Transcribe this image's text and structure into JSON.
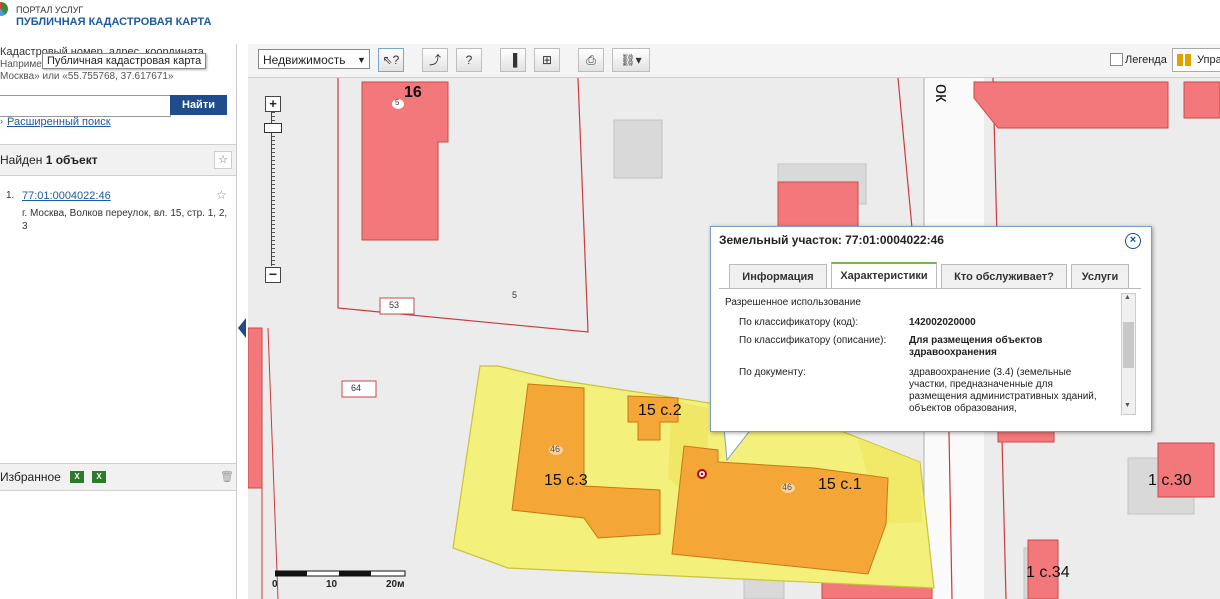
{
  "header": {
    "portal": "ПОРТАЛ УСЛУГ",
    "title": "ПУБЛИЧНАЯ КАДАСТРОВАЯ КАРТА"
  },
  "left": {
    "search_hint_line1": "Кадастровый номер, адрес, координата",
    "search_hint_line2": "Наприме",
    "search_hint_line3": "Москва» или «55.755768, 37.617671»",
    "tooltip": "Публичная кадастровая карта",
    "search_value": "",
    "find_button": "Найти",
    "advanced_search": "Расширенный поиск",
    "found_prefix": "Найден ",
    "found_count": "1 объект",
    "result_number": "1.",
    "result_link": "77:01:0004022:46",
    "result_address": "г. Москва, Волков переулок, вл. 15, стр. 1, 2, 3",
    "favorites": "Избранное"
  },
  "toolbar": {
    "dropdown": "Недвижимость",
    "legend": "Легенда",
    "manage": "Упра"
  },
  "map": {
    "labels": {
      "n16": "16",
      "s5a": "5",
      "n53": "53",
      "s5b": "5",
      "n64": "64",
      "n15s2": "15 с.2",
      "n15s3": "15 с.3",
      "n15s1": "15 с.1",
      "n46a": "46",
      "n46b": "46",
      "n1s30": "1 с.30",
      "n1s34": "1 с.34",
      "street": "ок"
    },
    "scale": {
      "l0": "0",
      "l10": "10",
      "l20": "20м"
    }
  },
  "popup": {
    "title": "Земельный участок: 77:01:0004022:46",
    "tabs": [
      "Информация",
      "Характеристики",
      "Кто обслуживает?",
      "Услуги"
    ],
    "section": "Разрешенное использование",
    "rows": [
      {
        "label": "По классификатору (код):",
        "value": "142002020000"
      },
      {
        "label": "По классификатору (описание):",
        "value": "Для размещения объектов здравоохранения"
      },
      {
        "label": "По документу:",
        "value": "здравоохранение (3.4) (земельные участки, предназначенные для размещения административных зданий, объектов образования,"
      }
    ]
  },
  "colors": {
    "building_red": "#f2787b",
    "parcel_yellow": "#f3f07c",
    "building_orange": "#f4a637",
    "map_bg": "#ececec",
    "accent_blue": "#1e4c8c"
  }
}
